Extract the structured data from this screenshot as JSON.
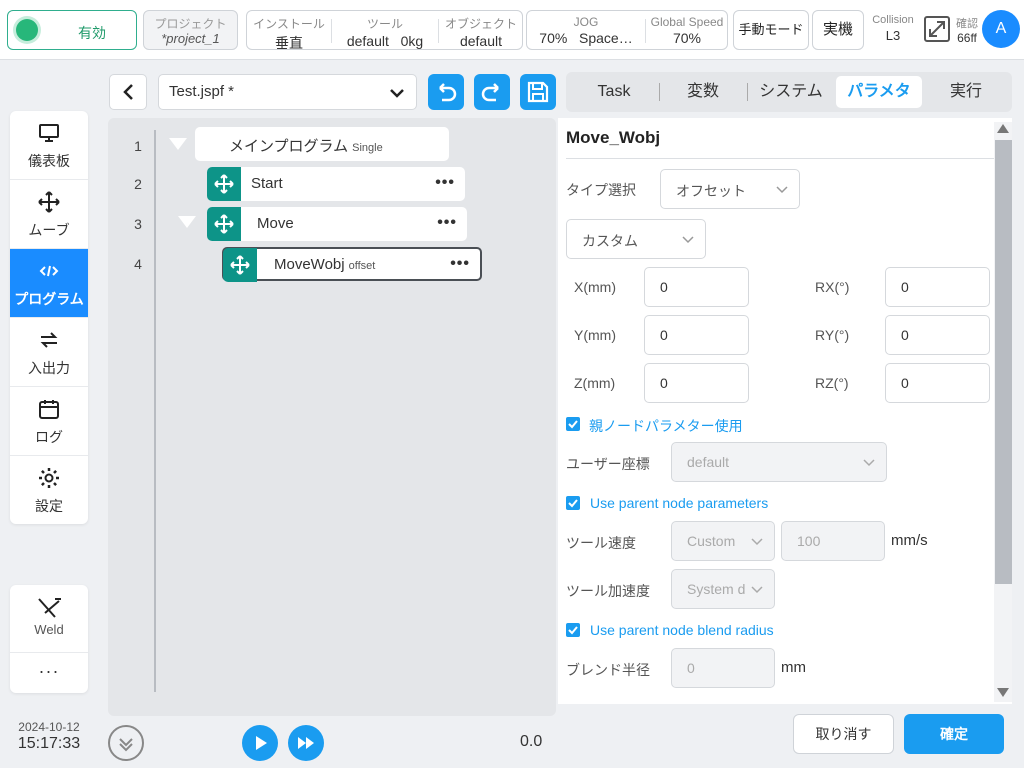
{
  "header": {
    "enable_label": "有効",
    "project_label": "プロジェクト",
    "project_value": "*project_1",
    "install_label": "インストール",
    "install_value": "垂直",
    "tool_label": "ツール",
    "tool_value": "default",
    "tool_payload": "0kg",
    "object_label": "オブジェクト",
    "object_value": "default",
    "jog_label": "JOG",
    "jog_value": "70%",
    "jog_frame": "Space…",
    "global_speed_label": "Global Speed",
    "global_speed_value": "70%",
    "mode_button": "手動モード",
    "real_button": "実機",
    "collision_label": "Collision",
    "collision_value": "L3",
    "confirm_label": "確認",
    "confirm_value": "66ff",
    "avatar_letter": "A"
  },
  "sidebar": {
    "items": [
      {
        "label": "儀表板",
        "icon": "monitor-icon"
      },
      {
        "label": "ムーブ",
        "icon": "move-arrows-icon"
      },
      {
        "label": "プログラム",
        "icon": "code-icon"
      },
      {
        "label": "入出力",
        "icon": "exchange-icon"
      },
      {
        "label": "ログ",
        "icon": "calendar-icon"
      },
      {
        "label": "設定",
        "icon": "gear-icon"
      }
    ],
    "active_index": 2,
    "weld_label": "Weld",
    "more_label": "···"
  },
  "clock": {
    "date": "2024-10-12",
    "time": "15:17:33"
  },
  "editor": {
    "file_name": "Test.jspf *",
    "lines": [
      "1",
      "2",
      "3",
      "4"
    ],
    "tree": {
      "main": {
        "name": "メインプログラム",
        "tag": "Single"
      },
      "start": {
        "name": "Start"
      },
      "move": {
        "name": "Move"
      },
      "movewobj": {
        "name": "MoveWobj",
        "tag": "offset"
      }
    },
    "speed_readout": "0.0"
  },
  "tabs": [
    {
      "label": "Task"
    },
    {
      "label": "変数"
    },
    {
      "label": "システム"
    },
    {
      "label": "パラメタ"
    },
    {
      "label": "実行"
    }
  ],
  "active_tab": 3,
  "params": {
    "title": "Move_Wobj",
    "type_label": "タイプ選択",
    "type_value": "オフセット",
    "custom_value": "カスタム",
    "x_label": "X(mm)",
    "x_value": "0",
    "y_label": "Y(mm)",
    "y_value": "0",
    "z_label": "Z(mm)",
    "z_value": "0",
    "rx_label": "RX(°)",
    "rx_value": "0",
    "ry_label": "RY(°)",
    "ry_value": "0",
    "rz_label": "RZ(°)",
    "rz_value": "0",
    "parent_node_jp": "親ノードパラメター使用",
    "user_coord_label": "ユーザー座標",
    "user_coord_value": "default",
    "use_parent_params": "Use parent node parameters",
    "tool_speed_label": "ツール速度",
    "tool_speed_mode": "Custom",
    "tool_speed_value": "100",
    "tool_speed_unit": "mm/s",
    "tool_accel_label": "ツール加速度",
    "tool_accel_mode": "System d",
    "use_parent_blend": "Use parent node blend radius",
    "blend_label": "ブレンド半径",
    "blend_value": "0",
    "blend_unit": "mm"
  },
  "footer": {
    "cancel": "取り消す",
    "confirm": "確定"
  },
  "colors": {
    "accent": "#1a9cf0",
    "enable_green": "#27b77a",
    "node_teal": "#0d9488"
  }
}
